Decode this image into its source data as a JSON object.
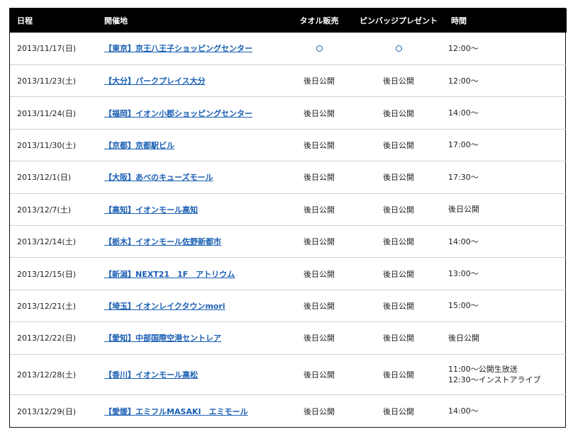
{
  "table": {
    "headers": {
      "date": "日程",
      "venue": "開催地",
      "towel": "タオル販売",
      "badge": "ピンバッジプレゼント",
      "time": "時間"
    },
    "rows": [
      {
        "date": "2013/11/17(日)",
        "venue": "【東京】京王八王子ショッピングセンター",
        "towel": "○",
        "badge": "○",
        "time": [
          "12:00～"
        ]
      },
      {
        "date": "2013/11/23(土)",
        "venue": "【大分】パークプレイス大分",
        "towel": "後日公開",
        "badge": "後日公開",
        "time": [
          "12:00～"
        ]
      },
      {
        "date": "2013/11/24(日)",
        "venue": "【福岡】イオン小郡ショッピングセンター",
        "towel": "後日公開",
        "badge": "後日公開",
        "time": [
          "14:00～"
        ]
      },
      {
        "date": "2013/11/30(土)",
        "venue": "【京都】京都駅ビル",
        "towel": "後日公開",
        "badge": "後日公開",
        "time": [
          "17:00～"
        ]
      },
      {
        "date": "2013/12/1(日)",
        "venue": "【大阪】あべのキューズモール",
        "towel": "後日公開",
        "badge": "後日公開",
        "time": [
          "17:30～"
        ]
      },
      {
        "date": "2013/12/7(土)",
        "venue": "【高知】イオンモール高知",
        "towel": "後日公開",
        "badge": "後日公開",
        "time": [
          "後日公開"
        ]
      },
      {
        "date": "2013/12/14(土)",
        "venue": "【栃木】イオンモール佐野新都市",
        "towel": "後日公開",
        "badge": "後日公開",
        "time": [
          "14:00～"
        ]
      },
      {
        "date": "2013/12/15(日)",
        "venue": "【新潟】NEXT21　1F　アトリウム",
        "towel": "後日公開",
        "badge": "後日公開",
        "time": [
          "13:00～"
        ]
      },
      {
        "date": "2013/12/21(土)",
        "venue": "【埼玉】イオンレイクタウンmori",
        "towel": "後日公開",
        "badge": "後日公開",
        "time": [
          "15:00～"
        ]
      },
      {
        "date": "2013/12/22(日)",
        "venue": "【愛知】中部国際空港セントレア",
        "towel": "後日公開",
        "badge": "後日公開",
        "time": [
          "後日公開"
        ]
      },
      {
        "date": "2013/12/28(土)",
        "venue": "【香川】イオンモール高松",
        "towel": "後日公開",
        "badge": "後日公開",
        "time": [
          "11:00～公開生放送",
          "12:30～インストアライブ"
        ]
      },
      {
        "date": "2013/12/29(日)",
        "venue": "【愛媛】エミフルMASAKI　エミモール",
        "towel": "後日公開",
        "badge": "後日公開",
        "time": [
          "14:00～"
        ]
      }
    ]
  },
  "colors": {
    "header_bg": "#000000",
    "header_text": "#ffffff",
    "link": "#1a5fb4",
    "row_divider": "#cfcfcf"
  },
  "icons": {
    "available_mark": "circle-icon"
  }
}
